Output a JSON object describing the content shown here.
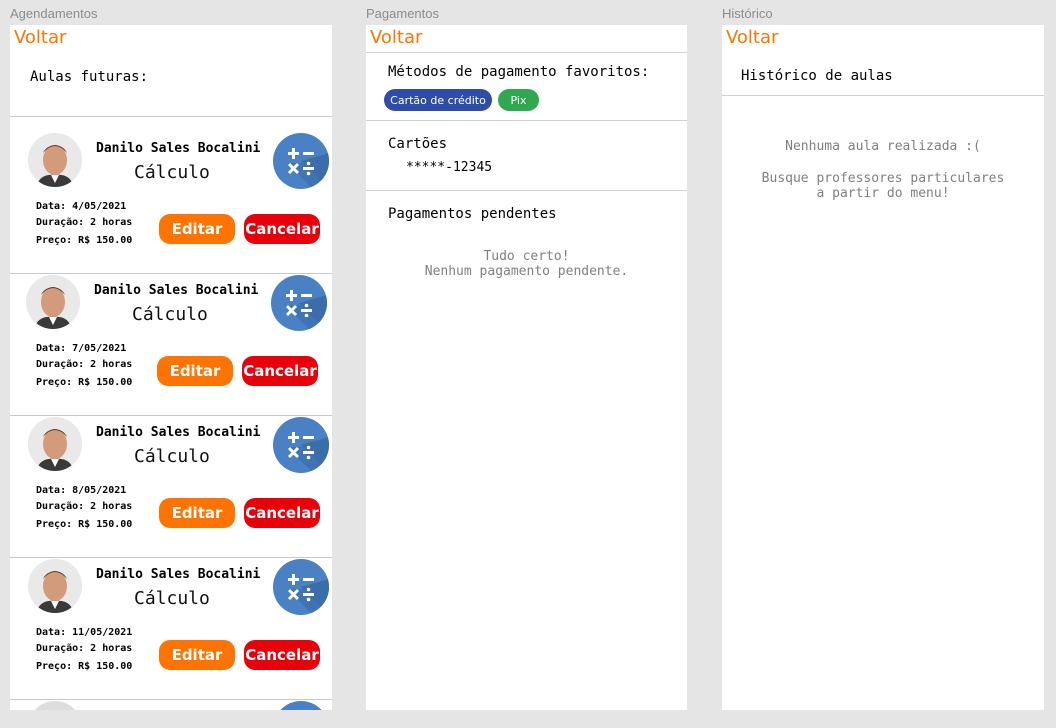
{
  "frames": {
    "agendamentos": {
      "label": "Agendamentos",
      "back": "Voltar",
      "title": "Aulas futuras:",
      "lessons": [
        {
          "teacher": "Danilo Sales Bocalini",
          "subject": "Cálculo",
          "date": "Data: 4/05/2021",
          "duration": "Duração: 2 horas",
          "price": "Preço: R$ 150.00",
          "edit": "Editar",
          "cancel": "Cancelar"
        },
        {
          "teacher": "Danilo Sales Bocalini",
          "subject": "Cálculo",
          "date": "Data: 7/05/2021",
          "duration": "Duração: 2 horas",
          "price": "Preço: R$ 150.00",
          "edit": "Editar",
          "cancel": "Cancelar"
        },
        {
          "teacher": "Danilo Sales Bocalini",
          "subject": "Cálculo",
          "date": "Data: 8/05/2021",
          "duration": "Duração: 2 horas",
          "price": "Preço: R$ 150.00",
          "edit": "Editar",
          "cancel": "Cancelar"
        },
        {
          "teacher": "Danilo Sales Bocalini",
          "subject": "Cálculo",
          "date": "Data: 11/05/2021",
          "duration": "Duração: 2 horas",
          "price": "Preço: R$ 150.00",
          "edit": "Editar",
          "cancel": "Cancelar"
        }
      ],
      "subject_icon": "math-operators-icon"
    },
    "pagamentos": {
      "label": "Pagamentos",
      "back": "Voltar",
      "favorites_title": "Métodos de pagamento favoritos:",
      "favorites": [
        {
          "label": "Cartão de crédito",
          "color": "#2e4da7"
        },
        {
          "label": "Pix",
          "color": "#2fa84f"
        }
      ],
      "cards_title": "Cartões",
      "card_number": "*****-12345",
      "pending_title": "Pagamentos pendentes",
      "pending_empty": "Tudo certo!\nNenhum pagamento pendente."
    },
    "historico": {
      "label": "Histórico",
      "back": "Voltar",
      "title": "Histórico de aulas",
      "empty": "Nenhuma aula realizada :(",
      "hint": "Busque professores particulares\na partir do menu!"
    }
  },
  "colors": {
    "accent": "#ff7300",
    "cancel": "#e8000b",
    "subject_icon_bg": "#4a80c4"
  }
}
